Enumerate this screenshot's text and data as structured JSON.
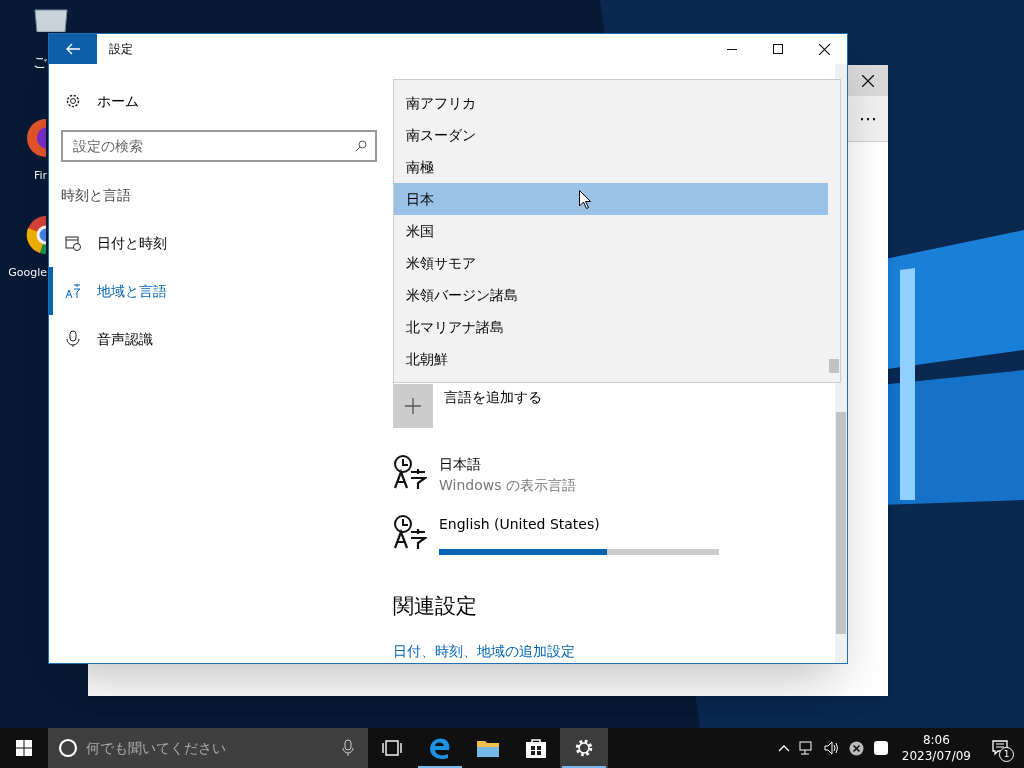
{
  "desktop_icons": [
    {
      "label": "ご",
      "kind": "bin"
    },
    {
      "label": "Fir",
      "kind": "firefox"
    },
    {
      "label": "Google",
      "kind": "chrome"
    }
  ],
  "back_window": {
    "more": "⋯"
  },
  "window": {
    "title": "設定"
  },
  "sidebar": {
    "home": "ホーム",
    "search": {
      "placeholder": "設定の検索"
    },
    "section": "時刻と言語",
    "items": [
      {
        "label": "日付と時刻",
        "kind": "calendar",
        "selected": false
      },
      {
        "label": "地域と言語",
        "kind": "language",
        "selected": true
      },
      {
        "label": "音声認識",
        "kind": "mic",
        "selected": false
      }
    ]
  },
  "dropdown": {
    "options": [
      {
        "label": "南アフリカ",
        "selected": false
      },
      {
        "label": "南スーダン",
        "selected": false
      },
      {
        "label": "南極",
        "selected": false
      },
      {
        "label": "日本",
        "selected": true
      },
      {
        "label": "米国",
        "selected": false
      },
      {
        "label": "米領サモア",
        "selected": false
      },
      {
        "label": "米領バージン諸島",
        "selected": false
      },
      {
        "label": "北マリアナ諸島",
        "selected": false
      },
      {
        "label": "北朝鮮",
        "selected": false
      }
    ]
  },
  "content": {
    "add_language": "言語を追加する",
    "languages": [
      {
        "name": "日本語",
        "subtitle": "Windows の表示言語"
      },
      {
        "name": "English (United States)",
        "level": 0.6
      }
    ],
    "related_heading": "関連設定",
    "related_link": "日付、時刻、地域の追加設定"
  },
  "taskbar": {
    "search_placeholder": "何でも聞いてください",
    "apps": [
      {
        "kind": "taskview",
        "active": false,
        "running": false
      },
      {
        "kind": "edge",
        "active": false,
        "running": true
      },
      {
        "kind": "explorer",
        "active": false,
        "running": false
      },
      {
        "kind": "store",
        "active": false,
        "running": false
      },
      {
        "kind": "settings",
        "active": true,
        "running": true
      }
    ],
    "time": "8:06",
    "date": "2023/07/09",
    "notifications": "1"
  }
}
